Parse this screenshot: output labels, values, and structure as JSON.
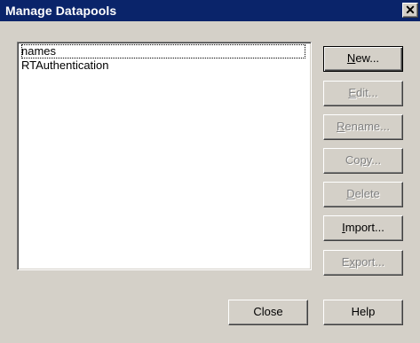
{
  "dialog": {
    "title": "Manage Datapools",
    "close_glyph": "✕"
  },
  "list": {
    "items": [
      {
        "label": "names",
        "focused": true
      },
      {
        "label": "RTAuthentication",
        "focused": false
      }
    ]
  },
  "buttons": {
    "new": {
      "accel": "N",
      "rest": "ew...",
      "enabled": true
    },
    "edit": {
      "accel": "E",
      "rest": "dit...",
      "enabled": false
    },
    "rename": {
      "accel": "R",
      "rest": "ename...",
      "enabled": false
    },
    "copy": {
      "pre": "Co",
      "accel": "p",
      "rest": "y...",
      "enabled": false
    },
    "delete": {
      "accel": "D",
      "rest": "elete",
      "enabled": false
    },
    "import": {
      "accel": "I",
      "rest": "mport...",
      "enabled": true
    },
    "export": {
      "pre": "E",
      "accel": "x",
      "rest": "port...",
      "enabled": false
    },
    "close": {
      "label": "Close",
      "enabled": true
    },
    "help": {
      "label": "Help",
      "enabled": true
    }
  }
}
